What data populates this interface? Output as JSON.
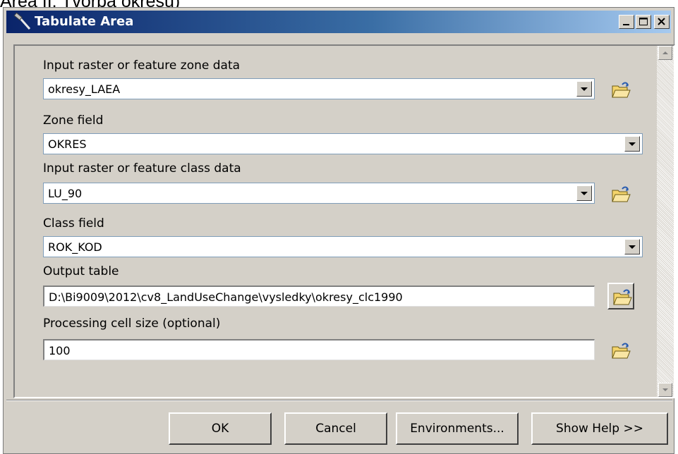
{
  "background_text": "Area II: Tvorba okresů)",
  "window": {
    "title": "Tabulate Area",
    "titlebar_gradient": [
      "#0a246a",
      "#a6caf0"
    ]
  },
  "params": {
    "zone_data": {
      "label": "Input raster or feature zone data",
      "value": "okresy_LAEA"
    },
    "zone_field": {
      "label": "Zone field",
      "value": "OKRES"
    },
    "class_data": {
      "label": "Input raster or feature class data",
      "value": "LU_90"
    },
    "class_field": {
      "label": "Class field",
      "value": "ROK_KOD"
    },
    "output_table": {
      "label": "Output table",
      "value": "D:\\Bi9009\\2012\\cv8_LandUseChange\\vysledky\\okresy_clc1990"
    },
    "cell_size": {
      "label": "Processing cell size (optional)",
      "value": "100"
    }
  },
  "buttons": {
    "ok": "OK",
    "cancel": "Cancel",
    "environments": "Environments...",
    "show_help": "Show Help >>"
  },
  "icons": {
    "title": "hammer-icon",
    "browse": "open-folder-icon",
    "dropdown": "chevron-down-icon"
  }
}
